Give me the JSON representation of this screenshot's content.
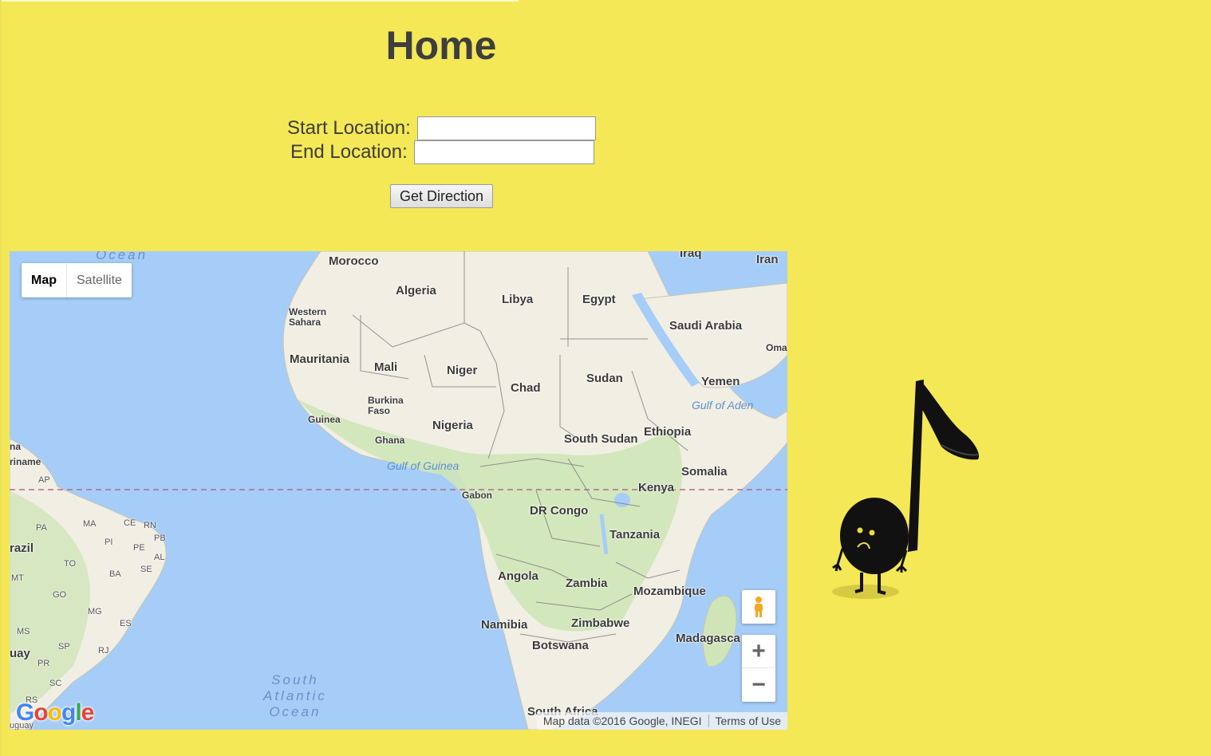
{
  "page": {
    "title": "Home"
  },
  "form": {
    "start_label": "Start Location:",
    "start_value": "",
    "end_label": "End Location:",
    "end_value": "",
    "submit_label": "Get Direction"
  },
  "map": {
    "type_controls": {
      "map": "Map",
      "satellite": "Satellite"
    },
    "attribution": "Map data ©2016 Google, INEGI",
    "terms": "Terms of Use",
    "logo": "Google",
    "labels": {
      "morocco": "Morocco",
      "algeria": "Algeria",
      "libya": "Libya",
      "egypt": "Egypt",
      "iraq": "Iraq",
      "iran": "Iran",
      "saudi": "Saudi Arabia",
      "oman": "Oma",
      "western_sahara": "Western\nSahara",
      "mauritania": "Mauritania",
      "mali": "Mali",
      "niger": "Niger",
      "chad": "Chad",
      "sudan": "Sudan",
      "yemen": "Yemen",
      "gulf_aden": "Gulf of Aden",
      "burkina": "Burkina\nFaso",
      "guinea": "Guinea",
      "nigeria": "Nigeria",
      "ghana": "Ghana",
      "south_sudan": "South Sudan",
      "ethiopia": "Ethiopia",
      "gulf_guinea": "Gulf of Guinea",
      "somalia": "Somalia",
      "kenya": "Kenya",
      "gabon": "Gabon",
      "dr_congo": "DR Congo",
      "tanzania": "Tanzania",
      "angola": "Angola",
      "zambia": "Zambia",
      "mozambique": "Mozambique",
      "namibia": "Namibia",
      "zimbabwe": "Zimbabwe",
      "botswana": "Botswana",
      "madagascar": "Madagasca",
      "south_africa": "South Africa",
      "ocean_top": "Ocean",
      "south_atlantic": "South\nAtlantic\nOcean",
      "brazil": "razil",
      "suriname": "riname",
      "na": "na",
      "ap": "AP",
      "pa": "PA",
      "ma": "MA",
      "ce": "CE",
      "rn": "RN",
      "pi": "PI",
      "pb": "PB",
      "pe": "PE",
      "al": "AL",
      "to": "TO",
      "ba": "BA",
      "se": "SE",
      "mt": "MT",
      "go": "GO",
      "mg": "MG",
      "es": "ES",
      "ms": "MS",
      "sp": "SP",
      "rj": "RJ",
      "pr": "PR",
      "sc": "SC",
      "rs": "RS",
      "uay": "uay",
      "uguay": "uguay"
    }
  },
  "icons": {
    "pegman": "pegman-icon",
    "zoom_in": "+",
    "zoom_out": "−",
    "mascot": "music-note-mascot"
  },
  "colors": {
    "background": "#f4e856",
    "water": "#a6cdf8",
    "land": "#f1efe4",
    "vegetation": "#cfe5b8"
  }
}
